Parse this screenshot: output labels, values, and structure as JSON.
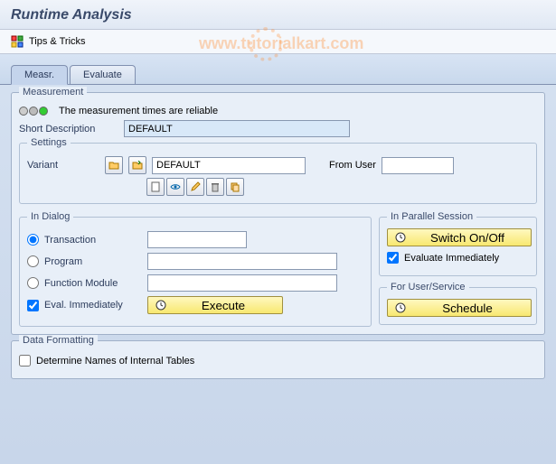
{
  "header": {
    "title": "Runtime Analysis"
  },
  "subheader": {
    "tips_label": "Tips & Tricks"
  },
  "tabs": {
    "measr": "Measr.",
    "evaluate": "Evaluate"
  },
  "measurement": {
    "group_title": "Measurement",
    "status_text": "The measurement times are reliable",
    "short_desc_label": "Short Description",
    "short_desc_value": "DEFAULT",
    "settings": {
      "title": "Settings",
      "variant_label": "Variant",
      "variant_value": "DEFAULT",
      "from_user_label": "From User",
      "from_user_value": ""
    }
  },
  "in_dialog": {
    "title": "In Dialog",
    "transaction_label": "Transaction",
    "program_label": "Program",
    "fm_label": "Function Module",
    "eval_label": "Eval. Immediately",
    "execute_label": "Execute"
  },
  "parallel": {
    "title": "In Parallel Session",
    "switch_label": "Switch On/Off",
    "eval_label": "Evaluate Immediately"
  },
  "userservice": {
    "title": "For User/Service",
    "schedule_label": "Schedule"
  },
  "formatting": {
    "title": "Data Formatting",
    "determine_label": "Determine Names of Internal Tables"
  },
  "watermark": "www.tutorialkart.com"
}
